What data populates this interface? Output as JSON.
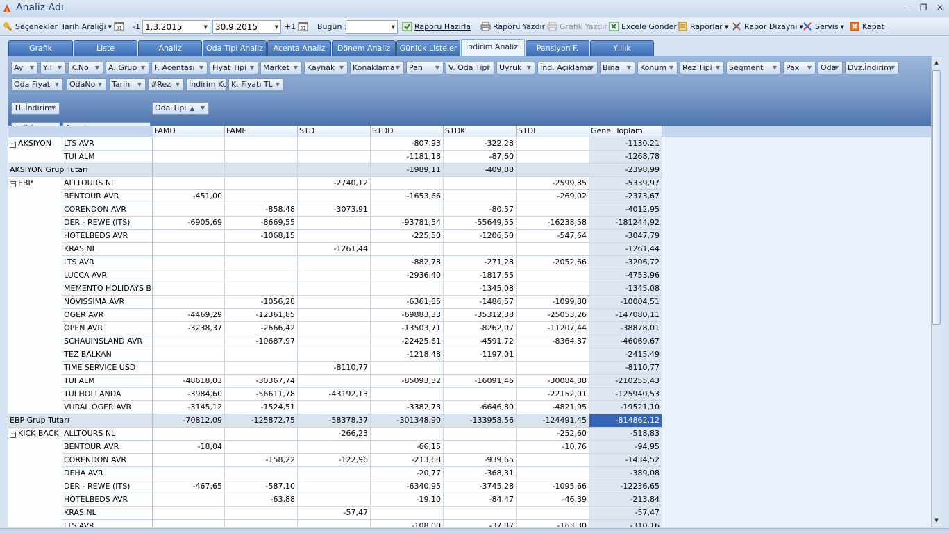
{
  "window": {
    "title": "Analiz Adı",
    "minimize": "–",
    "restore": "❐",
    "close": "✕"
  },
  "toolbar": {
    "options": "Seçenekler",
    "date_range": "Tarih Aralığı",
    "minus_one": "-1",
    "start_date": "1.3.2015",
    "end_date": "30.9.2015",
    "plus_one": "+1",
    "today_label": "Bugün :",
    "today_value": "",
    "prepare_report": "Raporu Hazırla",
    "print_report": "Raporu Yazdır",
    "print_chart": "Grafik Yazdır",
    "send_excel": "Excele Gönder",
    "reports": "Raporlar",
    "report_design": "Rapor Dizaynı",
    "service": "Servis",
    "close": "Kapat"
  },
  "tabs": [
    "Grafik",
    "Liste",
    "Analiz",
    "Oda Tipi Analiz",
    "Acenta Analiz",
    "Dönem Analiz",
    "Günlük Listeler",
    "İndirim Analizi",
    "Pansiyon F.",
    "Yıllık"
  ],
  "active_tab": "İndirim Analizi",
  "filter_fields_row1": [
    "Ay",
    "Yıl",
    "K.No",
    "A. Grup",
    "F. Acentası",
    "Fiyat Tipi",
    "Market",
    "Kaynak",
    "Konaklama",
    "Pan",
    "V. Oda Tipi",
    "Uyruk",
    "İnd. Açıklama",
    "Bina",
    "Konum",
    "Rez Tipi",
    "Segment",
    "Pax",
    "Oda",
    "Dvz.İndirim"
  ],
  "filter_fields_row2": [
    "Oda Fiyatı",
    "OdaNo",
    "Tarih",
    "#Rez",
    "İndirim Kodu",
    "K. Fiyatı TL"
  ],
  "data_field": "TL İndirim",
  "column_field": "Oda Tipi",
  "row_fields": [
    "İndirim",
    "Acenta"
  ],
  "columns": [
    "FAMD",
    "FAME",
    "STD",
    "STDD",
    "STDK",
    "STDL",
    "Genel Toplam"
  ],
  "rows": [
    {
      "group": "AKSIYON",
      "agency": "LTS AVR",
      "v": [
        "",
        "",
        "",
        "-807,93",
        "-322,28",
        "",
        "-1130,21"
      ]
    },
    {
      "group": "",
      "agency": "TUI ALM",
      "v": [
        "",
        "",
        "",
        "-1181,18",
        "-87,60",
        "",
        "-1268,78"
      ]
    },
    {
      "subtotal": "AKSIYON Grup Tutarı",
      "v": [
        "",
        "",
        "",
        "-1989,11",
        "-409,88",
        "",
        "-2398,99"
      ]
    },
    {
      "group": "EBP",
      "agency": "ALLTOURS NL",
      "v": [
        "",
        "",
        "-2740,12",
        "",
        "",
        "-2599,85",
        "-5339,97"
      ]
    },
    {
      "group": "",
      "agency": "BENTOUR AVR",
      "v": [
        "-451,00",
        "",
        "",
        "-1653,66",
        "",
        "-269,02",
        "-2373,67"
      ]
    },
    {
      "group": "",
      "agency": "CORENDON AVR",
      "v": [
        "",
        "-858,48",
        "-3073,91",
        "",
        "-80,57",
        "",
        "-4012,95"
      ]
    },
    {
      "group": "",
      "agency": "DER - REWE (ITS)",
      "v": [
        "-6905,69",
        "-8669,55",
        "",
        "-93781,54",
        "-55649,55",
        "-16238,58",
        "-181244,92"
      ]
    },
    {
      "group": "",
      "agency": "HOTELBEDS AVR",
      "v": [
        "",
        "-1068,15",
        "",
        "-225,50",
        "-1206,50",
        "-547,64",
        "-3047,79"
      ]
    },
    {
      "group": "",
      "agency": "KRAS.NL",
      "v": [
        "",
        "",
        "-1261,44",
        "",
        "",
        "",
        "-1261,44"
      ]
    },
    {
      "group": "",
      "agency": "LTS AVR",
      "v": [
        "",
        "",
        "",
        "-882,78",
        "-271,28",
        "-2052,66",
        "-3206,72"
      ]
    },
    {
      "group": "",
      "agency": "LUCCA AVR",
      "v": [
        "",
        "",
        "",
        "-2936,40",
        "-1817,55",
        "",
        "-4753,96"
      ]
    },
    {
      "group": "",
      "agency": "MEMENTO HOLIDAYS B...",
      "v": [
        "",
        "",
        "",
        "",
        "-1345,08",
        "",
        "-1345,08"
      ]
    },
    {
      "group": "",
      "agency": "NOVISSIMA AVR",
      "v": [
        "",
        "-1056,28",
        "",
        "-6361,85",
        "-1486,57",
        "-1099,80",
        "-10004,51"
      ]
    },
    {
      "group": "",
      "agency": "OGER AVR",
      "v": [
        "-4469,29",
        "-12361,85",
        "",
        "-69883,33",
        "-35312,38",
        "-25053,26",
        "-147080,11"
      ]
    },
    {
      "group": "",
      "agency": "OPEN AVR",
      "v": [
        "-3238,37",
        "-2666,42",
        "",
        "-13503,71",
        "-8262,07",
        "-11207,44",
        "-38878,01"
      ]
    },
    {
      "group": "",
      "agency": "SCHAUINSLAND AVR",
      "v": [
        "",
        "-10687,97",
        "",
        "-22425,61",
        "-4591,72",
        "-8364,37",
        "-46069,67"
      ]
    },
    {
      "group": "",
      "agency": "TEZ BALKAN",
      "v": [
        "",
        "",
        "",
        "-1218,48",
        "-1197,01",
        "",
        "-2415,49"
      ]
    },
    {
      "group": "",
      "agency": "TIME SERVICE USD",
      "v": [
        "",
        "",
        "-8110,77",
        "",
        "",
        "",
        "-8110,77"
      ]
    },
    {
      "group": "",
      "agency": "TUI ALM",
      "v": [
        "-48618,03",
        "-30367,74",
        "",
        "-85093,32",
        "-16091,46",
        "-30084,88",
        "-210255,43"
      ]
    },
    {
      "group": "",
      "agency": "TUI HOLLANDA",
      "v": [
        "-3984,60",
        "-56611,78",
        "-43192,13",
        "",
        "",
        "-22152,01",
        "-125940,53"
      ]
    },
    {
      "group": "",
      "agency": "VURAL OGER AVR",
      "v": [
        "-3145,12",
        "-1524,51",
        "",
        "-3382,73",
        "-6646,80",
        "-4821,95",
        "-19521,10"
      ]
    },
    {
      "subtotal": "EBP Grup Tutarı",
      "v": [
        "-70812,09",
        "-125872,75",
        "-58378,37",
        "-301348,90",
        "-133958,56",
        "-124491,45",
        "-814862,12"
      ]
    },
    {
      "group": "KICK BACK",
      "agency": "ALLTOURS NL",
      "v": [
        "",
        "",
        "-266,23",
        "",
        "",
        "-252,60",
        "-518,83"
      ]
    },
    {
      "group": "",
      "agency": "BENTOUR AVR",
      "v": [
        "-18,04",
        "",
        "",
        "-66,15",
        "",
        "-10,76",
        "-94,95"
      ]
    },
    {
      "group": "",
      "agency": "CORENDON AVR",
      "v": [
        "",
        "-158,22",
        "-122,96",
        "-213,68",
        "-939,65",
        "",
        "-1434,52"
      ]
    },
    {
      "group": "",
      "agency": "DEHA AVR",
      "v": [
        "",
        "",
        "",
        "-20,77",
        "-368,31",
        "",
        "-389,08"
      ]
    },
    {
      "group": "",
      "agency": "DER - REWE (ITS)",
      "v": [
        "-467,65",
        "-587,10",
        "",
        "-6340,95",
        "-3745,28",
        "-1095,66",
        "-12236,65"
      ]
    },
    {
      "group": "",
      "agency": "HOTELBEDS AVR",
      "v": [
        "",
        "-63,88",
        "",
        "-19,10",
        "-84,47",
        "-46,39",
        "-213,84"
      ]
    },
    {
      "group": "",
      "agency": "KRAS.NL",
      "v": [
        "",
        "",
        "-57,47",
        "",
        "",
        "",
        "-57,47"
      ]
    },
    {
      "group": "",
      "agency": "LTS AVR",
      "v": [
        "",
        "",
        "",
        "-108,00",
        "-37,87",
        "-163,30",
        "-310,16"
      ]
    }
  ],
  "selected_cell": "-814862,12"
}
